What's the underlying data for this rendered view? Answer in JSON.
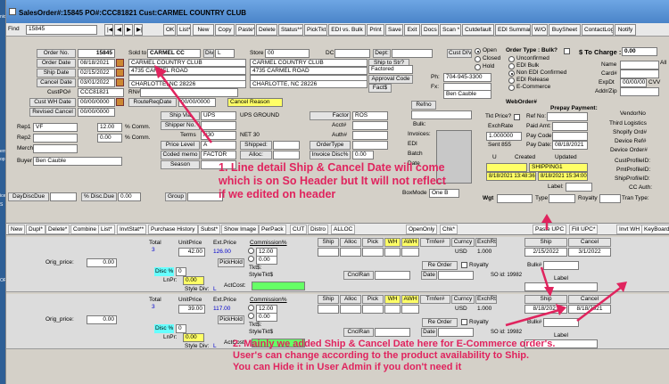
{
  "window": {
    "title": "SalesOrder#:15845  PO#:CCC81821  Cust:CARMEL COUNTRY CLUB"
  },
  "toolbar": {
    "find_label": "Find",
    "find_value": "15845",
    "buttons": [
      "OK",
      "List*",
      "New",
      "Copy",
      "Paste*",
      "Delete",
      "Status**",
      "PickTkt",
      "EDI vs. Bulk",
      "Print",
      "Save",
      "Exit",
      "Docs",
      "Scan *",
      "Cutdefault",
      "EDI Summary",
      "W/O",
      "BuySheet",
      "ContactLog",
      "Notify"
    ]
  },
  "header": {
    "order_no_label": "Order No.",
    "order_no": "15845",
    "order_date_label": "Order Date",
    "order_date": "08/18/2021",
    "ship_date_label": "Ship Date",
    "ship_date": "02/15/2022",
    "cancel_date_label": "Cancel Date",
    "cancel_date": "03/01/2022",
    "custpo_label": "CustPO#",
    "custpo": "CCC81821",
    "custwh_label": "Cust WH Date",
    "custwh": "00/00/0000",
    "revised_label": "Revised Cancel",
    "revised": "00/00/0000",
    "route_label": "RouteReqDate",
    "route": "00/00/0000",
    "cancel_reason": "Cancel Reason",
    "rn_label": "RN#",
    "sold_to_label": "Sold to",
    "sold_to": "CARMEL CC",
    "div_label": "Div",
    "div": "L",
    "sold_name": "CARMEL COUNTRY CLUB",
    "sold_addr": "4735 CARMEL ROAD",
    "sold_city": "CHARLOTTE, NC 28226",
    "store_label": "Store",
    "store": "00",
    "dc_label": "DC",
    "ship_name": "CARMEL COUNTRY CLUB",
    "ship_addr": "4735 CARMEL ROAD",
    "ship_city": "CHARLOTTE, NC 28226",
    "dept_label": "Dept:",
    "ship_to_str": "Ship to Str?",
    "factored": "Factored",
    "approval_code": "Approval Code",
    "fact_label": "Fact$",
    "ph_label": "Ph:",
    "ph": "704-945-3300",
    "fx_label": "Fx:",
    "contact": "Ben Cauble",
    "custdiv_label": "Cust DIV",
    "status_open": "Open",
    "status_closed": "Closed",
    "status_hold": "Hold",
    "order_type_label": "Order Type : Bulk?",
    "otype_unconfirmed": "Unconfirmed",
    "otype_edi_bulk": "EDI Bulk",
    "otype_non_edi": "Non EDI Confirmed",
    "otype_edi_release": "EDI Release",
    "otype_ecom": "E-Commerce",
    "to_charge_label": "$ To Charge :",
    "to_charge": "0.00",
    "all_label": "All",
    "name_label": "Name",
    "card_label": "Card#",
    "expdt_label": "ExpDt",
    "expdt": "00/00/00",
    "cvv_label": "CVV",
    "addrzip_label": "Addr/Zip"
  },
  "mid": {
    "shipvia_label": "Ship Via",
    "shipvia": "UPS",
    "shipvia_desc": "UPS GROUND",
    "shipperno_label": "Shipper No.",
    "terms_label": "Terms",
    "terms": "N30",
    "terms_desc": "NET 30",
    "pricelevel_label": "Price Level",
    "pricelevel": "A",
    "codedmemo_label": "Coded memo",
    "codedmemo": "FACTOR",
    "season_label": "Season",
    "shipped_label": "Shipped:",
    "alloc_label": "Alloc:",
    "factor_label": "Factor",
    "factor": "ROS",
    "acct_label": "Acct#",
    "auth_label": "Auth#",
    "ordertype_label": "OrderType",
    "invoicedisc_label": "Invoice Disc%",
    "invoicedisc": "0.00",
    "rep1_label": "Rep1",
    "rep1": "VF",
    "rep1_pct": "12.00",
    "rep2_label": "Rep2",
    "rep2_pct": "0.00",
    "comm_label": "% Comm.",
    "merch_label": "Merch",
    "buyer_label": "Buyer",
    "buyer": "Ben Cauble",
    "daydisc_label": "DayDiscDue",
    "pctdisc_label": "% Disc.Due",
    "pctdisc": "0.00",
    "group_label": "Group",
    "refno_label": "Refno",
    "bulk_label": "Bulk:",
    "invoices_label": "Invoices:",
    "edi_label": "EDI",
    "batch_label": "Batch",
    "date_label": "Date",
    "boxmode_label": "BoxMode",
    "boxmode": "One B",
    "tkt_price_label": "Tkt Price?",
    "ref_no_label": "Ref No:",
    "exchrate_label": "ExchRate",
    "exchrate": "1.000000",
    "paidamt_label": "Paid Amt:",
    "sent_label": "Sent 855",
    "paycode_label": "Pay Code:",
    "paydate_label": "Pay Date:",
    "paydate": "08/18/2021",
    "webhorder_label": "WebOrder#",
    "prepay_label": "Prepay Payment:",
    "created_label": "Created",
    "updated_label": "Updated",
    "created_val": "SHIPPING1",
    "created_ts": "8/18/2021 13:48:36",
    "updated_ts": "8/18/2021 15:34:00",
    "label_label": "Label:",
    "wgt_label": "Wgt",
    "type_label": "Type",
    "royalty_label": "Royalty",
    "vendorno_label": "VendorNo",
    "third_label": "Third Logistics",
    "shopify_label": "Shopify Ord#",
    "devref_label": "Device Ref#",
    "devorder_label": "Device Order#",
    "custprofile_label": "CustProfileID:",
    "pmtprofile_label": "PmtProfileID:",
    "shipprofile_label": "ShipProfileID:",
    "ccauth_label": "CC Auth:",
    "trantype_label": "Tran Type:"
  },
  "tabs": [
    "New",
    "Dupl*",
    "Delete*",
    "Combine",
    "List*",
    "InvtStat**",
    "Purchase History",
    "Subst*",
    "Show Image",
    "PerPack",
    "CUT",
    "Distro",
    "ALLOC",
    "OpenOnly",
    "Chk*",
    "Paste UPC",
    "Fill UPC*",
    "Invt WH",
    "KeyBoard"
  ],
  "lines": [
    {
      "total_label": "Total",
      "total": "3",
      "unitprice_label": "UnitPrice",
      "unitprice": "42.00",
      "extprice_label": "Ext.Price",
      "extprice": "126.00",
      "orig_label": "Orig_price:",
      "orig": "0.00",
      "pickhold": "PickHold",
      "commission": "Commission%",
      "comm": "12.00",
      "comm2": "0.00",
      "tkt": "Tkt$:",
      "styletkt": "StyleTkt$",
      "actcost": "ActCost:",
      "disc": "Disc %",
      "disc_val": "0",
      "lnpr_label": "LnPr:",
      "lnpr": "0.00",
      "styldiv_label": "Style Div:",
      "styldiv": "L",
      "currency": "USD",
      "exch": "1.000",
      "ship": "2/15/2022",
      "cancel": "3/1/2022",
      "soid": "SO id: 19982",
      "bulk": "Bulk#"
    },
    {
      "total_label": "Total",
      "total": "3",
      "unitprice_label": "UnitPrice",
      "unitprice": "39.00",
      "extprice_label": "Ext.Price",
      "extprice": "117.00",
      "orig_label": "Orig_price:",
      "orig": "0.00",
      "pickhold": "PickHold",
      "commission": "Commission%",
      "comm": "12.00",
      "comm2": "0.00",
      "tkt": "Tkt$:",
      "styletkt": "StyleTkt$",
      "actcost": "ActCost:",
      "disc": "Disc %",
      "disc_val": "0",
      "lnpr_label": "LnPr:",
      "lnpr": "0.00",
      "styldiv_label": "Style Div:",
      "styldiv": "L",
      "currency": "USD",
      "exch": "1.000",
      "ship": "8/18/2021",
      "cancel": "8/18/2021",
      "soid": "SO id: 19982",
      "bulk": "Bulk#"
    }
  ],
  "line_headers": [
    "Ship",
    "Alloc",
    "Pick",
    "WH",
    "AWH",
    "Trnfer#",
    "Curncy",
    "ExchRt",
    "Ship",
    "Cancel"
  ],
  "line_extra": {
    "reorder": "Re Order",
    "royalty": "Royalty",
    "cnclran": "CnclRan",
    "date": "Date",
    "label": "Label"
  },
  "annotations": {
    "note1_line1": "1. Line detail Ship & Cancel Date will come",
    "note1_line2": "which is on So Header but It will not reflect",
    "note1_line3": "if we edited on header",
    "note2_line1": "2. Mainly we added Ship & Cancel Date here for E-Commerce order's.",
    "note2_line2": "User's can change according to the product availability to Ship.",
    "note2_line3": "You can Hide it in User Admin if you don't need it"
  },
  "colors": {
    "annotation": "#e0245e",
    "highlight_yellow": "#ffff66",
    "highlight_cyan": "#66ffff",
    "highlight_green": "#66ff66"
  },
  "desktop": {
    "items": [
      "nior",
      "erry",
      "op",
      "ice",
      "S",
      "OR."
    ]
  }
}
